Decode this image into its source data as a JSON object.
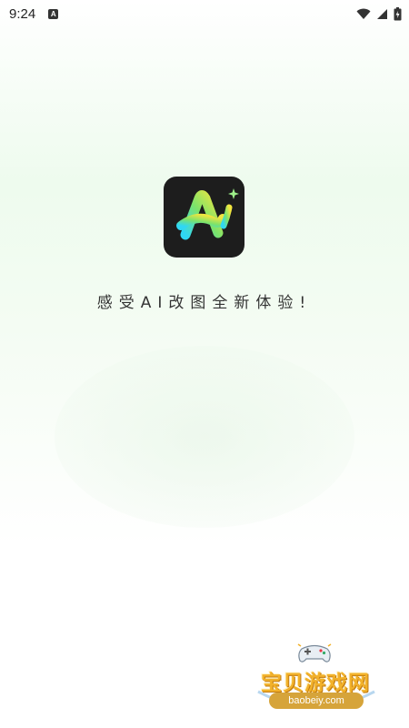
{
  "status_bar": {
    "time": "9:24",
    "app_badge": "A",
    "icons": [
      "wifi-icon",
      "signal-icon",
      "battery-icon"
    ]
  },
  "splash": {
    "logo_icon": "ai-logo-icon",
    "tagline": "感受AI改图全新体验!"
  },
  "watermark": {
    "title": "宝贝游戏网",
    "url": "baobeiy.com"
  },
  "colors": {
    "logo_bg": "#1d1d1d",
    "logo_gradient": [
      "#2fd7f4",
      "#7be36b",
      "#f2e53f"
    ],
    "watermark_gold": "#f2b12a"
  }
}
